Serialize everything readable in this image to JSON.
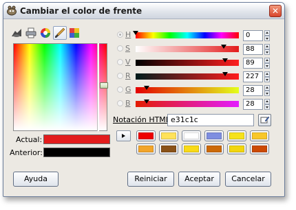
{
  "window": {
    "title": "Cambiar el color de frente"
  },
  "tools": [
    {
      "name": "gimp-selector-icon"
    },
    {
      "name": "cmyk-printer-icon"
    },
    {
      "name": "color-wheel-icon"
    },
    {
      "name": "watercolor-brush-icon"
    },
    {
      "name": "scales-icon"
    }
  ],
  "current": {
    "label": "Actual:",
    "color": "#e31c1c"
  },
  "previous": {
    "label": "Anterior:",
    "color": "#000000"
  },
  "channels": [
    {
      "label": "H",
      "value": "0",
      "marker_pos": 0.0,
      "selected": true
    },
    {
      "label": "S",
      "value": "88",
      "marker_pos": 0.88,
      "selected": false
    },
    {
      "label": "V",
      "value": "89",
      "marker_pos": 0.89,
      "selected": false
    },
    {
      "label": "R",
      "value": "227",
      "marker_pos": 0.89,
      "selected": false
    },
    {
      "label": "G",
      "value": "28",
      "marker_pos": 0.11,
      "selected": false
    },
    {
      "label": "B",
      "value": "28",
      "marker_pos": 0.11,
      "selected": false
    }
  ],
  "html_notation": {
    "label": "Notación HTML:",
    "value": "e31c1c"
  },
  "history": [
    "#ee0000",
    "#ffe25a",
    "#ffffff",
    "#7e8ee0",
    "#f6e21a",
    "#f8c72a",
    "#f2a52a",
    "#8a5218",
    "#f8da18",
    "#cc6a08",
    "#f2d60e",
    "#cc4a04"
  ],
  "buttons": {
    "help": "Ayuda",
    "reset": "Reiniciar",
    "accept": "Aceptar",
    "cancel": "Cancelar"
  }
}
